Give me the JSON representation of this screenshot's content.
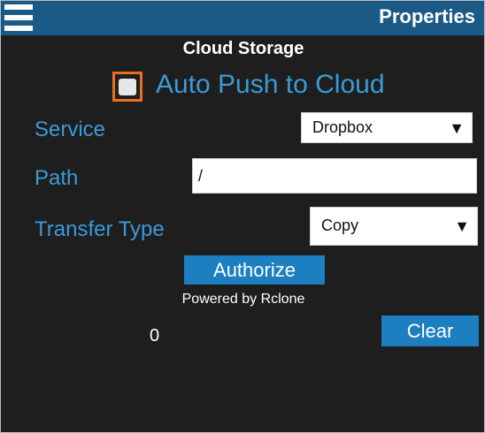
{
  "header": {
    "title": "Properties",
    "menu_icon": "hamburger-menu-icon"
  },
  "section": {
    "title": "Cloud Storage"
  },
  "auto_push": {
    "label": "Auto Push to Cloud",
    "checked": false
  },
  "service": {
    "label": "Service",
    "value": "Dropbox",
    "arrow": "▼"
  },
  "path": {
    "label": "Path",
    "value": "/"
  },
  "transfer_type": {
    "label": "Transfer Type",
    "value": "Copy",
    "arrow": "▼"
  },
  "authorize_button": {
    "label": "Authorize"
  },
  "powered_by": "Powered by Rclone",
  "counter": "0",
  "clear_button": {
    "label": "Clear"
  },
  "colors": {
    "header_bg": "#1b5a86",
    "panel_bg": "#1e1e1e",
    "label_blue": "#3a9ad9",
    "button_blue": "#1e7fc0",
    "focus_orange": "#e8701a"
  }
}
